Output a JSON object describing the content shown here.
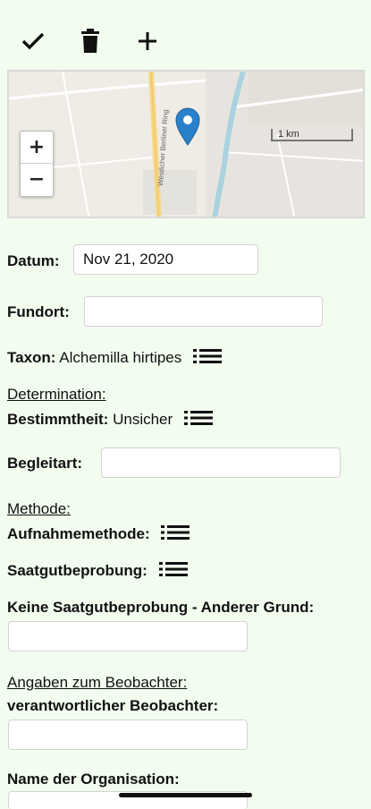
{
  "toolbar": {
    "icons": [
      "check-icon",
      "trash-icon",
      "plus-icon"
    ]
  },
  "map": {
    "road_label": "Westlicher Berliner Ring",
    "scale_label": "1 km",
    "zoom_in": "+",
    "zoom_out": "−"
  },
  "form": {
    "datum_label": "Datum:",
    "datum_value": "Nov 21, 2020",
    "fundort_label": "Fundort:",
    "fundort_value": "",
    "taxon_label": "Taxon:",
    "taxon_value": "Alchemilla hirtipes",
    "determination_header": "Determination:",
    "bestimmtheit_label": "Bestimmtheit:",
    "bestimmtheit_value": "Unsicher",
    "begleitart_label": "Begleitart:",
    "begleitart_value": "",
    "methode_header": "Methode:",
    "aufnahmemethode_label": "Aufnahmemethode:",
    "saatgut_label": "Saatgutbeprobung:",
    "keine_saatgut_label": "Keine Saatgutbeprobung - Anderer Grund:",
    "keine_saatgut_value": "",
    "beobachter_header": "Angaben zum Beobachter:",
    "verantwortlicher_label": "verantwortlicher Beobachter:",
    "verantwortlicher_value": "",
    "organisation_label": "Name der Organisation:"
  }
}
